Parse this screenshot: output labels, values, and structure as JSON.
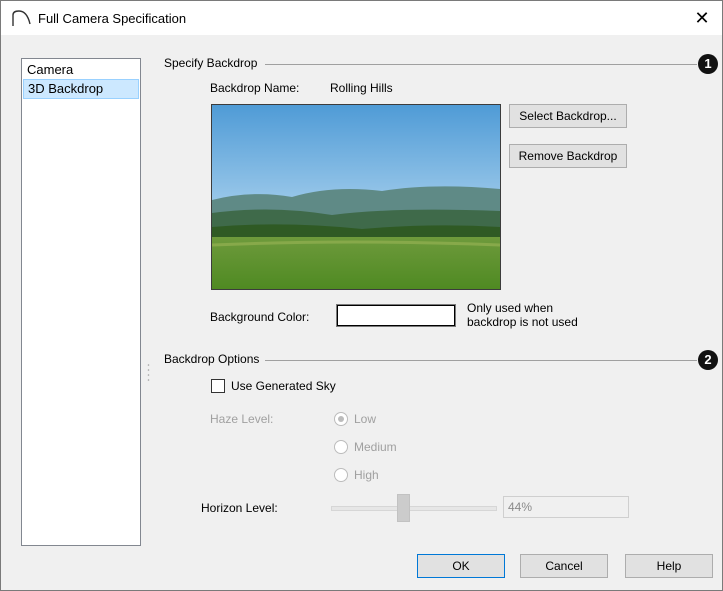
{
  "window": {
    "title": "Full Camera Specification",
    "close_glyph": "✕"
  },
  "sidebar": {
    "items": [
      {
        "label": "Camera",
        "selected": false
      },
      {
        "label": "3D Backdrop",
        "selected": true
      }
    ]
  },
  "specify_backdrop": {
    "section_title": "Specify Backdrop",
    "badge": "1",
    "name_label": "Backdrop Name:",
    "name_value": "Rolling Hills",
    "select_button": "Select Backdrop...",
    "remove_button": "Remove Backdrop",
    "background_color_label": "Background Color:",
    "background_color": "#ffffff",
    "note": [
      "Only used when",
      "backdrop is not used"
    ]
  },
  "backdrop_options": {
    "section_title": "Backdrop Options",
    "badge": "2",
    "use_generated_sky_label": "Use Generated Sky",
    "use_generated_sky_checked": false,
    "haze_label": "Haze Level:",
    "haze_options": [
      "Low",
      "Medium",
      "High"
    ],
    "haze_selected": "Low",
    "horizon_label": "Horizon Level:",
    "horizon_value": "44%",
    "horizon_fraction": 0.44
  },
  "footer": {
    "ok": "OK",
    "cancel": "Cancel",
    "help": "Help"
  },
  "colors": {
    "selection_bg": "#cce8ff",
    "default_button_border": "#0078d7"
  },
  "icons": {
    "title": "camera-arc-icon",
    "close": "close-icon",
    "badges": "numbered-callout-icon"
  }
}
